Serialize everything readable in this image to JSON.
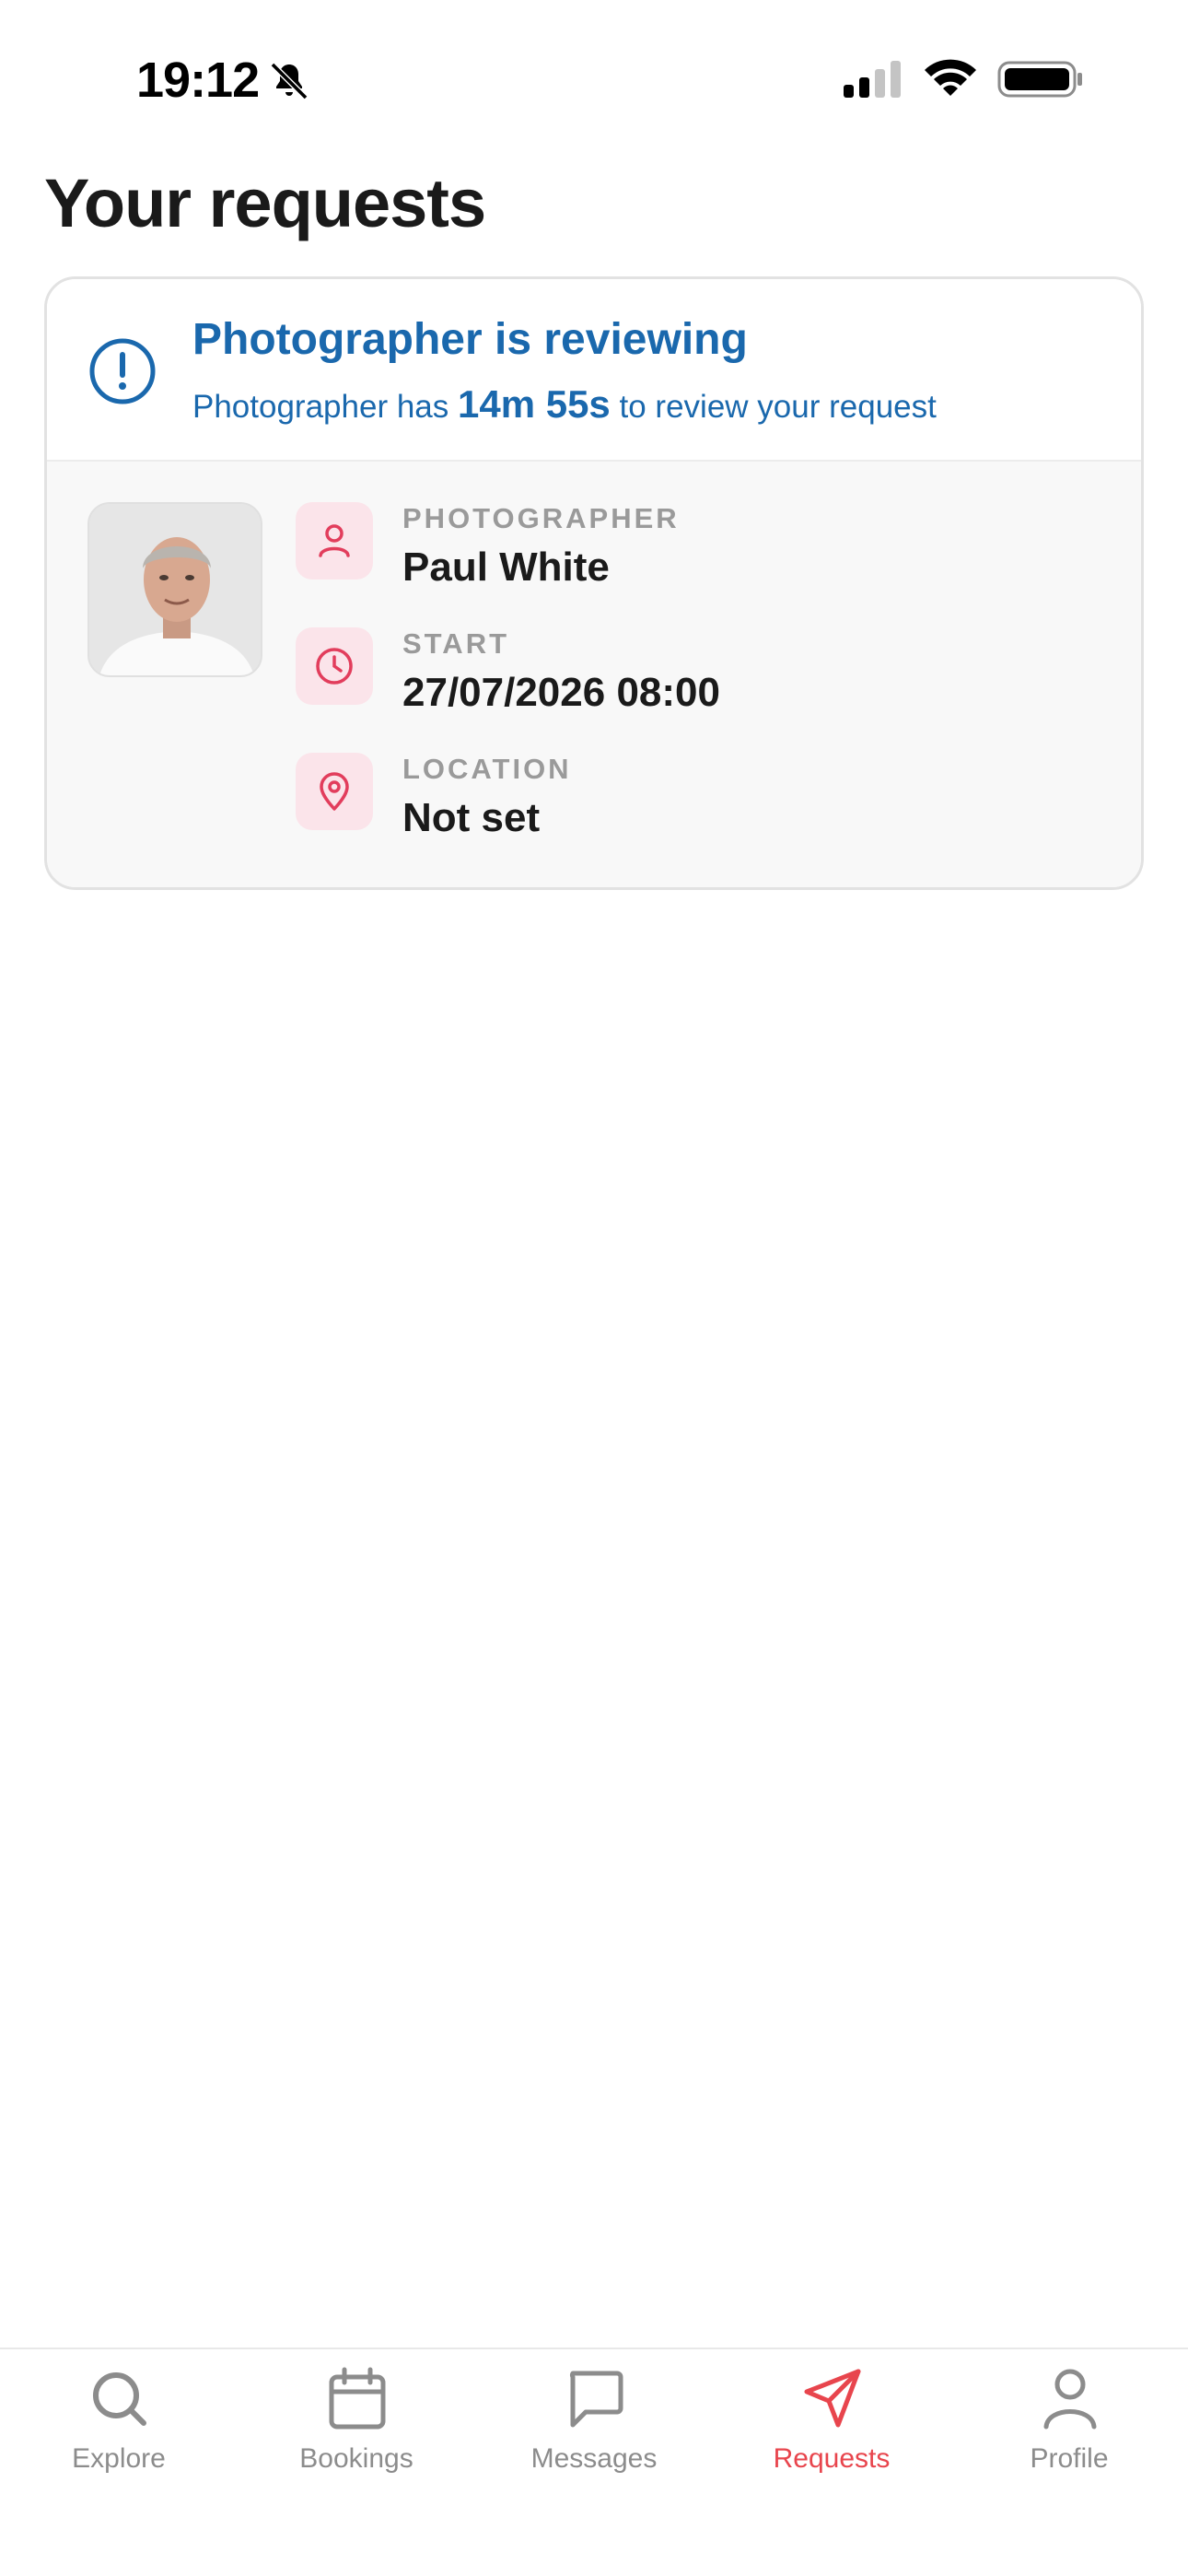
{
  "status_bar": {
    "time": "19:12"
  },
  "page": {
    "title": "Your requests"
  },
  "request_card": {
    "status_title": "Photographer is reviewing",
    "status_sub_prefix": "Photographer has ",
    "status_timer": "14m 55s",
    "status_sub_suffix": " to review your request",
    "details": [
      {
        "icon": "person-icon",
        "label": "PHOTOGRAPHER",
        "value": "Paul White"
      },
      {
        "icon": "clock-icon",
        "label": "START",
        "value": "27/07/2026 08:00"
      },
      {
        "icon": "location-pin-icon",
        "label": "LOCATION",
        "value": "Not set"
      }
    ]
  },
  "tab_bar": {
    "tabs": [
      {
        "icon": "search-icon",
        "label": "Explore",
        "active": false
      },
      {
        "icon": "calendar-icon",
        "label": "Bookings",
        "active": false
      },
      {
        "icon": "chat-bubble-icon",
        "label": "Messages",
        "active": false
      },
      {
        "icon": "paper-plane-icon",
        "label": "Requests",
        "active": true
      },
      {
        "icon": "person-icon",
        "label": "Profile",
        "active": false
      }
    ]
  },
  "colors": {
    "status_blue": "#1a68ad",
    "accent_red": "#e8454d",
    "icon_pink_bg": "#fbe4ea",
    "inactive_gray": "#8c8c8c"
  }
}
